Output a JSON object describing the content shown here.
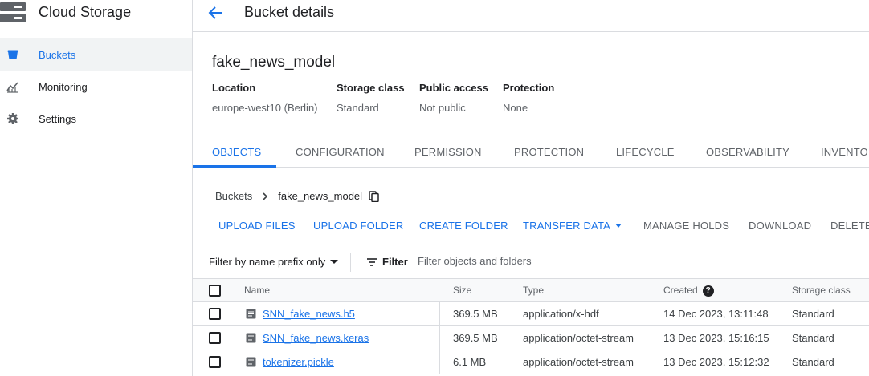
{
  "nav": {
    "title": "Cloud Storage",
    "items": [
      {
        "label": "Buckets"
      },
      {
        "label": "Monitoring"
      },
      {
        "label": "Settings"
      }
    ]
  },
  "header": {
    "title": "Bucket details"
  },
  "bucket": {
    "name": "fake_news_model",
    "meta": [
      {
        "key": "Location",
        "value": "europe-west10 (Berlin)"
      },
      {
        "key": "Storage class",
        "value": "Standard"
      },
      {
        "key": "Public access",
        "value": "Not public"
      },
      {
        "key": "Protection",
        "value": "None"
      }
    ]
  },
  "tabs": [
    "OBJECTS",
    "CONFIGURATION",
    "PERMISSION",
    "PROTECTION",
    "LIFECYCLE",
    "OBSERVABILITY",
    "INVENTORY"
  ],
  "breadcrumb": {
    "root": "Buckets",
    "current": "fake_news_model"
  },
  "actions": [
    "UPLOAD FILES",
    "UPLOAD FOLDER",
    "CREATE FOLDER",
    "TRANSFER DATA",
    "MANAGE HOLDS",
    "DOWNLOAD",
    "DELETE"
  ],
  "filter": {
    "prefix_label": "Filter by name prefix only",
    "button_label": "Filter",
    "placeholder": "Filter objects and folders"
  },
  "table": {
    "headers": {
      "name": "Name",
      "size": "Size",
      "type": "Type",
      "created": "Created",
      "storage_class": "Storage class"
    },
    "rows": [
      {
        "name": "SNN_fake_news.h5",
        "size": "369.5 MB",
        "type": "application/x-hdf",
        "created": "14 Dec 2023, 13:11:48",
        "storage_class": "Standard"
      },
      {
        "name": "SNN_fake_news.keras",
        "size": "369.5 MB",
        "type": "application/octet-stream",
        "created": "13 Dec 2023, 15:16:15",
        "storage_class": "Standard"
      },
      {
        "name": "tokenizer.pickle",
        "size": "6.1 MB",
        "type": "application/octet-stream",
        "created": "13 Dec 2023, 15:12:32",
        "storage_class": "Standard"
      }
    ]
  },
  "colors": {
    "accent": "#1a73e8",
    "border": "#dadce0",
    "text": "#202124",
    "muted": "#5f6368"
  }
}
